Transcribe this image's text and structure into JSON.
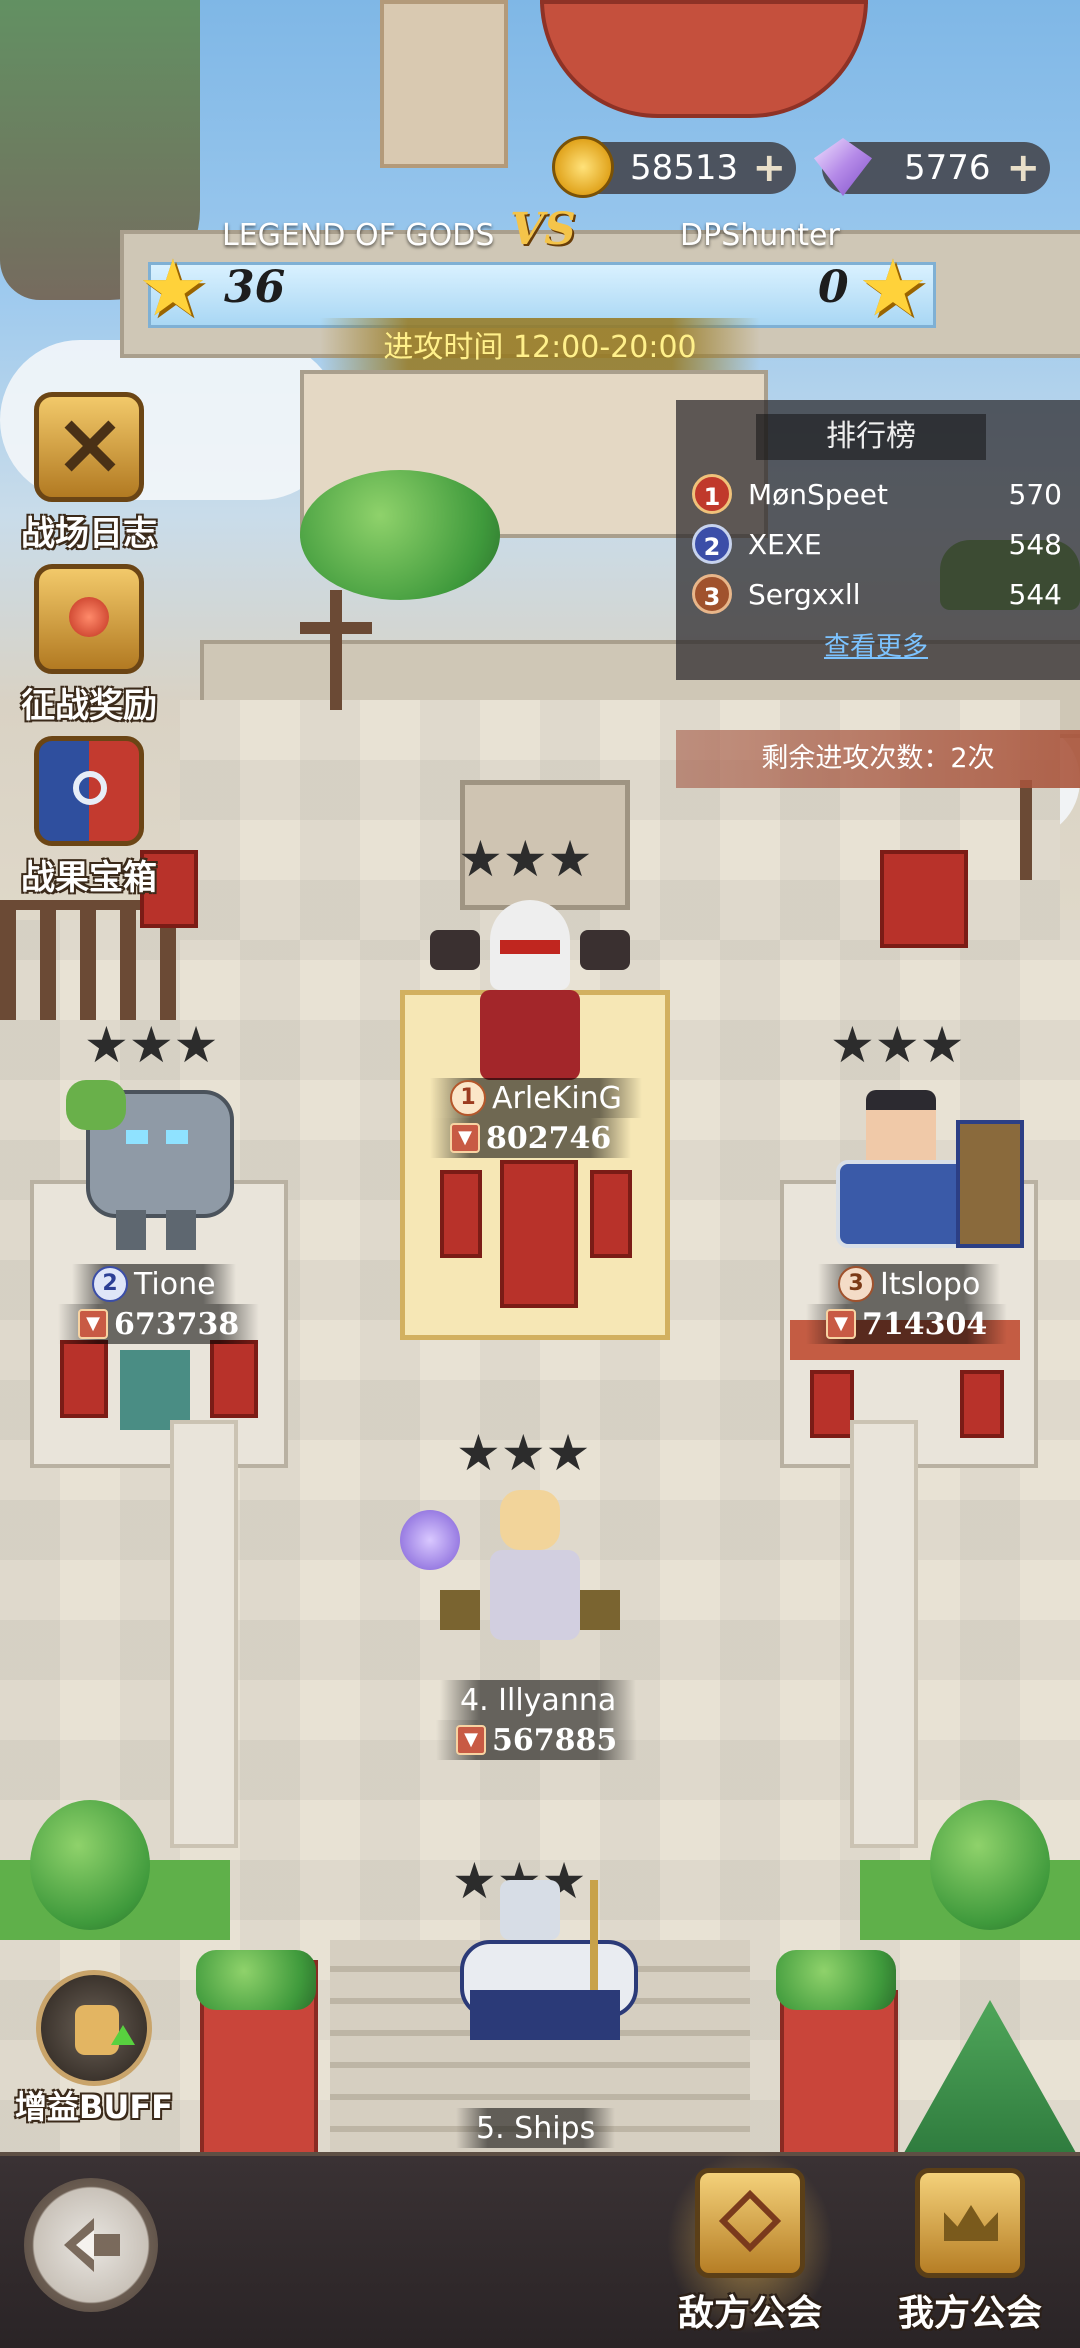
{
  "currency": {
    "gold": "58513",
    "gems": "5776"
  },
  "battle": {
    "left_team": "LEGEND OF GODS",
    "right_team": "DPShunter",
    "vs_label": "VS",
    "left_stars": "36",
    "right_stars": "0",
    "attack_time": "进攻时间 12:00-20:00"
  },
  "menu": {
    "log_label": "战场日志",
    "reward_label": "征战奖励",
    "chest_label": "战果宝箱",
    "buff_label": "增益BUFF"
  },
  "ranking": {
    "title": "排行榜",
    "rows": [
      {
        "rank": "1",
        "name": "MønSpeet",
        "score": "570"
      },
      {
        "rank": "2",
        "name": "XEXE",
        "score": "548"
      },
      {
        "rank": "3",
        "name": "Sergxxll",
        "score": "544"
      }
    ],
    "more_label": "查看更多"
  },
  "remaining_attacks": "剩余进攻次数：2次",
  "heroes": [
    {
      "rank": "1",
      "name": "ArleKinG",
      "power": "802746",
      "stars": 3
    },
    {
      "rank": "2",
      "name": "Tione",
      "power": "673738",
      "stars": 3
    },
    {
      "rank": "3",
      "name": "Itslopo",
      "power": "714304",
      "stars": 3
    },
    {
      "rank": "",
      "name": "4. Illyanna",
      "power": "567885",
      "stars": 3
    },
    {
      "rank": "",
      "name": "5. Ships",
      "power": "",
      "stars": 3
    }
  ],
  "tabs": {
    "enemy_guild": "敌方公会",
    "my_guild": "我方公会"
  },
  "colors": {
    "star_gold": "#ffd23a",
    "rank1": "#c0392b",
    "rank2": "#3b4ea8",
    "rank3": "#a0522d"
  },
  "icons": {
    "gold": "gold-coin-icon",
    "gem": "diamond-gem-icon",
    "back": "back-arrow-icon",
    "power": "power-crest-icon"
  }
}
